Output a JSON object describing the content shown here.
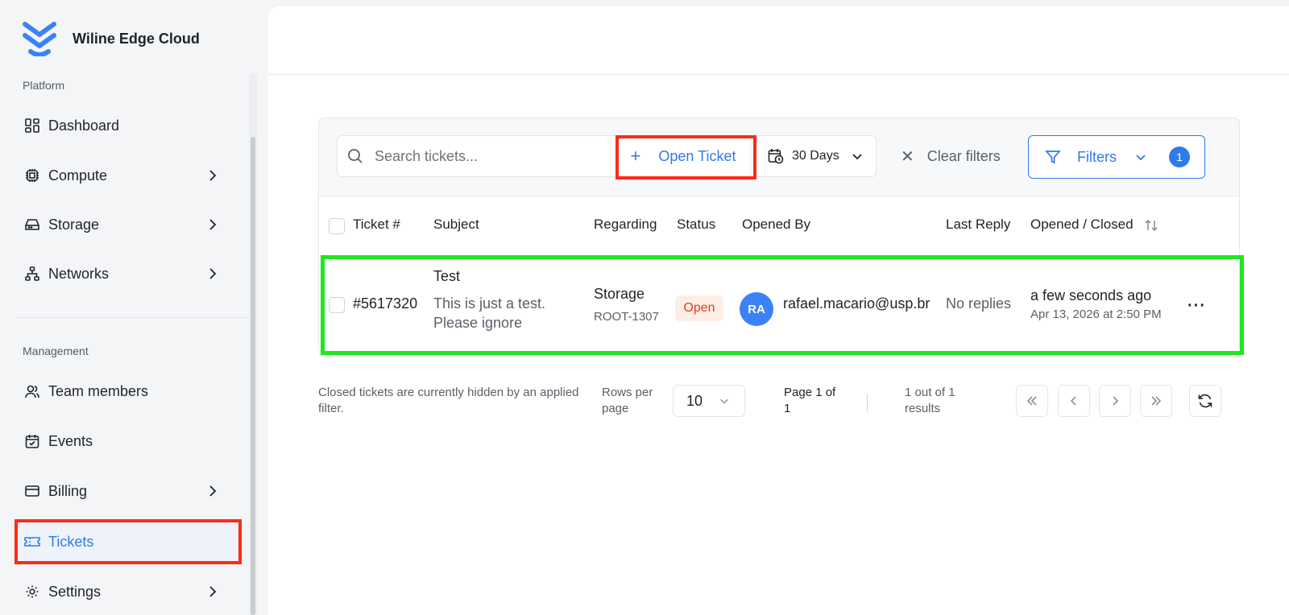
{
  "brand": {
    "name": "Wiline Edge Cloud"
  },
  "sidebar": {
    "platform_label": "Platform",
    "management_label": "Management",
    "platform_items": [
      {
        "label": "Dashboard",
        "icon": "dashboard-icon",
        "has_chevron": false
      },
      {
        "label": "Compute",
        "icon": "cpu-icon",
        "has_chevron": true
      },
      {
        "label": "Storage",
        "icon": "hard-drive-icon",
        "has_chevron": true
      },
      {
        "label": "Networks",
        "icon": "network-icon",
        "has_chevron": true
      }
    ],
    "management_items": [
      {
        "label": "Team members",
        "icon": "users-icon",
        "has_chevron": false
      },
      {
        "label": "Events",
        "icon": "calendar-check-icon",
        "has_chevron": false
      },
      {
        "label": "Billing",
        "icon": "credit-card-icon",
        "has_chevron": true
      },
      {
        "label": "Tickets",
        "icon": "ticket-icon",
        "has_chevron": false,
        "active": true
      },
      {
        "label": "Settings",
        "icon": "gear-icon",
        "has_chevron": true
      }
    ]
  },
  "toolbar": {
    "search_placeholder": "Search tickets...",
    "open_ticket_label": "Open Ticket",
    "date_range_label": "30 Days",
    "clear_filters_label": "Clear filters",
    "filters_label": "Filters",
    "filters_count": "1"
  },
  "table": {
    "headers": {
      "ticket": "Ticket #",
      "subject": "Subject",
      "regarding": "Regarding",
      "status": "Status",
      "opened_by": "Opened By",
      "last_reply": "Last Reply",
      "opened_closed": "Opened / Closed"
    },
    "rows": [
      {
        "ticket": "#5617320",
        "subject_title": "Test",
        "subject_line1": "This is just a test.",
        "subject_line2": "Please ignore",
        "regarding": "Storage",
        "regarding_sub": "ROOT-1307",
        "status": "Open",
        "avatar_initials": "RA",
        "opened_by": "rafael.macario@usp.br",
        "last_reply": "No replies",
        "opened_relative": "a few seconds ago",
        "opened_date": "Apr 13, 2026 at 2:50 PM"
      }
    ]
  },
  "footer": {
    "note_line1": "Closed tickets are currently hidden by an applied",
    "note_line2": "filter.",
    "rows_per_page_line1": "Rows per",
    "rows_per_page_line2": "page",
    "rows_per_page_value": "10",
    "page_line1": "Page 1 of",
    "page_line2": "1",
    "results_line1": "1 out of 1",
    "results_line2": "results"
  },
  "colors": {
    "accent": "#2f7bea",
    "status_open_bg": "#fdeee5",
    "status_open_text": "#e0401a",
    "highlight_red": "#ff2a16",
    "highlight_green": "#1ee81e"
  }
}
